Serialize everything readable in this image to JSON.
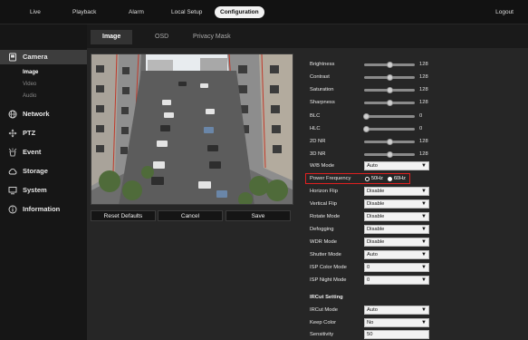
{
  "topnav": {
    "tabs": [
      "Live",
      "Playback",
      "Alarm",
      "Local Setup",
      "Configuration"
    ],
    "active": "Configuration",
    "logout": "Logout"
  },
  "sidebar": {
    "items": [
      {
        "label": "Camera",
        "icon": "camera-icon"
      },
      {
        "label": "Network",
        "icon": "globe-icon"
      },
      {
        "label": "PTZ",
        "icon": "move-icon"
      },
      {
        "label": "Event",
        "icon": "event-icon"
      },
      {
        "label": "Storage",
        "icon": "cloud-icon"
      },
      {
        "label": "System",
        "icon": "monitor-icon"
      },
      {
        "label": "Information",
        "icon": "info-icon"
      }
    ],
    "camera_sub": [
      "Image",
      "Video",
      "Audio"
    ]
  },
  "subtabs": [
    "Image",
    "OSD",
    "Privacy Mask"
  ],
  "buttons": {
    "reset": "Reset Defaults",
    "cancel": "Cancel",
    "save": "Save"
  },
  "sliders": [
    {
      "label": "Brightness",
      "value": "128",
      "level": 0.5
    },
    {
      "label": "Contrast",
      "value": "128",
      "level": 0.5
    },
    {
      "label": "Saturation",
      "value": "128",
      "level": 0.5
    },
    {
      "label": "Sharpness",
      "value": "128",
      "level": 0.5
    },
    {
      "label": "BLC",
      "value": "0",
      "level": 0.0
    },
    {
      "label": "HLC",
      "value": "0",
      "level": 0.0
    },
    {
      "label": "2D NR",
      "value": "128",
      "level": 0.5
    },
    {
      "label": "3D NR",
      "value": "128",
      "level": 0.5
    }
  ],
  "wb_mode": {
    "label": "W/B Mode",
    "value": "Auto"
  },
  "power_frequency": {
    "label": "Power Frequency",
    "opt1": "50Hz",
    "opt2": "60Hz",
    "selected": "60Hz"
  },
  "selects": [
    {
      "label": "Horizon Flip",
      "value": "Disable"
    },
    {
      "label": "Vertical Flip",
      "value": "Disable"
    },
    {
      "label": "Rotate Mode",
      "value": "Disable"
    },
    {
      "label": "Defogging",
      "value": "Disable"
    },
    {
      "label": "WDR Mode",
      "value": "Disable"
    },
    {
      "label": "Shutter Mode",
      "value": "Auto"
    },
    {
      "label": "ISP Color Mode",
      "value": "0"
    },
    {
      "label": "ISP Night Mode",
      "value": "0"
    }
  ],
  "ircut": {
    "title": "IRCut Setting",
    "mode": {
      "label": "IRCut Mode",
      "value": "Auto"
    },
    "keep_color": {
      "label": "Keep Color",
      "value": "No"
    },
    "sensitivity": {
      "label": "Sensitivity",
      "value": "50"
    }
  },
  "colors": {
    "accent": "#e02020",
    "bg": "#262626",
    "nav": "#121212"
  }
}
